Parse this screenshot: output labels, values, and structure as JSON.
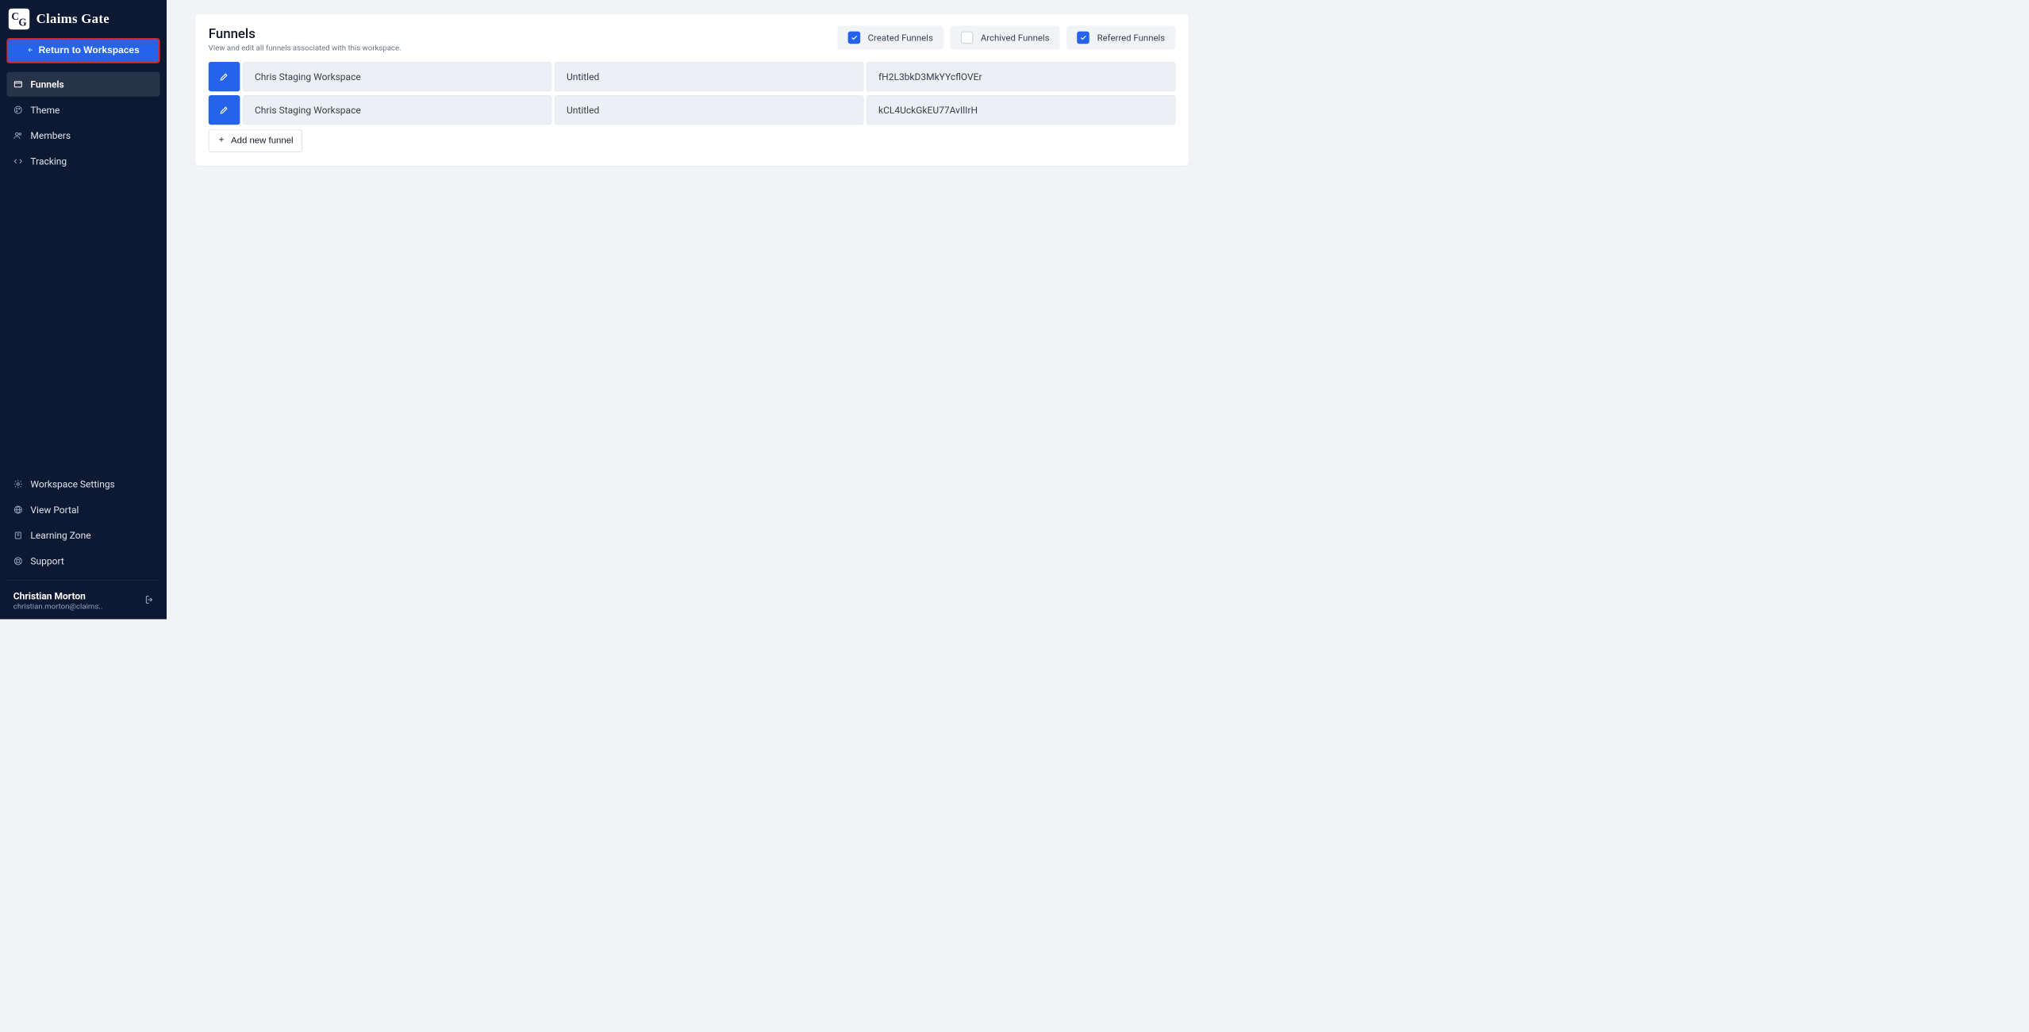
{
  "app": {
    "name": "Claims Gate"
  },
  "sidebar": {
    "return_label": "Return to Workspaces",
    "nav": [
      {
        "label": "Funnels",
        "icon": "window"
      },
      {
        "label": "Theme",
        "icon": "palette"
      },
      {
        "label": "Members",
        "icon": "users"
      },
      {
        "label": "Tracking",
        "icon": "code"
      }
    ],
    "lower": [
      {
        "label": "Workspace Settings",
        "icon": "gear"
      },
      {
        "label": "View Portal",
        "icon": "globe"
      },
      {
        "label": "Learning Zone",
        "icon": "book"
      },
      {
        "label": "Support",
        "icon": "life-ring"
      }
    ]
  },
  "user": {
    "name": "Christian Morton",
    "email": "christian.morton@claims.."
  },
  "main": {
    "title": "Funnels",
    "subtitle": "View and edit all funnels associated with this workspace.",
    "filters": {
      "created": {
        "label": "Created Funnels",
        "checked": true
      },
      "archived": {
        "label": "Archived Funnels",
        "checked": false
      },
      "referred": {
        "label": "Referred Funnels",
        "checked": true
      }
    },
    "rows": [
      {
        "workspace": "Chris Staging Workspace",
        "title": "Untitled",
        "id": "fH2L3bkD3MkYYcflOVEr"
      },
      {
        "workspace": "Chris Staging Workspace",
        "title": "Untitled",
        "id": "kCL4UckGkEU77AvIlIrH"
      }
    ],
    "add_label": "Add new funnel"
  }
}
